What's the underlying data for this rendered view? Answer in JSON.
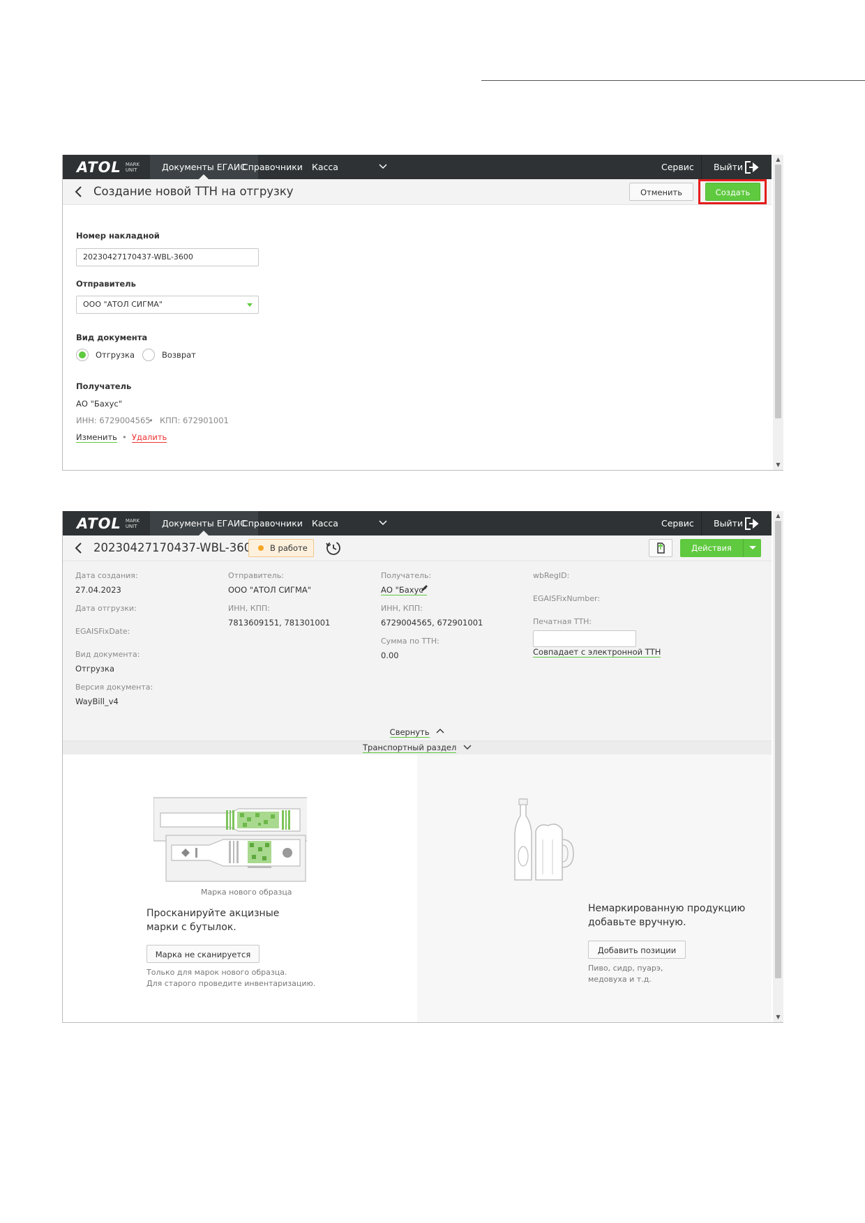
{
  "nav": {
    "logo": "ATOL",
    "logo_sub_1": "MARK",
    "logo_sub_2": "UNIT",
    "items": [
      "Документы ЕГАИС",
      "Справочники",
      "Касса"
    ],
    "service": "Сервис",
    "logout": "Выйти"
  },
  "form": {
    "title": "Создание новой ТТН на отгрузку",
    "cancel": "Отменить",
    "create": "Создать",
    "invoice_label": "Номер накладной",
    "invoice_value": "20230427170437-WBL-3600",
    "sender_label": "Отправитель",
    "sender_value": "ООО \"АТОЛ СИГМА\"",
    "doc_type_label": "Вид документа",
    "doc_type_options": [
      "Отгрузка",
      "Возврат"
    ],
    "doc_type_selected": "Отгрузка",
    "recipient_label": "Получатель",
    "recipient_name": "АО \"Бахус\"",
    "recipient_inn": "ИНН: 6729004565",
    "recipient_kpp": "КПП: 672901001",
    "change_link": "Изменить",
    "delete_link": "Удалить"
  },
  "doc": {
    "title": "20230427170437-WBL-3600",
    "status": "В работе",
    "actions": "Действия",
    "col1": {
      "created_label": "Дата создания:",
      "created_value": "27.04.2023",
      "shipped_label": "Дата отгрузки:",
      "fixdate_label": "EGAISFixDate:",
      "doctype_label": "Вид документа:",
      "doctype_value": "Отгрузка",
      "version_label": "Версия документа:",
      "version_value": "WayBill_v4"
    },
    "col2": {
      "sender_label": "Отправитель:",
      "sender_value": "ООО \"АТОЛ СИГМА\"",
      "inn_label": "ИНН, КПП:",
      "inn_value": "7813609151, 781301001"
    },
    "col3": {
      "recipient_label": "Получатель:",
      "recipient_value": "АО \"Бахус\"",
      "inn_label": "ИНН, КПП:",
      "inn_value": "6729004565, 672901001",
      "sum_label": "Сумма по ТТН:",
      "sum_value": "0.00"
    },
    "col4": {
      "wbregid_label": "wbRegID:",
      "fixnumber_label": "EGAISFixNumber:",
      "print_label": "Печатная ТТН:",
      "print_value": "",
      "match_link": "Совпадает с электронной ТТН"
    },
    "collapse": "Свернуть",
    "transport": "Транспортный раздел",
    "left_panel": {
      "caption": "Марка нового образца",
      "text_1": "Просканируйте акцизные",
      "text_2": "марки с бутылок.",
      "button": "Марка не сканируется",
      "note_1": "Только для марок нового образца.",
      "note_2": "Для старого проведите инвентаризацию."
    },
    "right_panel": {
      "text_1": "Немаркированную продукцию",
      "text_2": "добавьте вручную.",
      "button": "Добавить позиции",
      "note_1": "Пиво, сидр, пуарэ,",
      "note_2": "медовуха и т.д."
    }
  },
  "colors": {
    "accent": "#5fc93f",
    "navbar": "#2e3234",
    "highlight": "#e51c1c",
    "status_bg": "#fdf1de",
    "link_red": "#e33333"
  }
}
